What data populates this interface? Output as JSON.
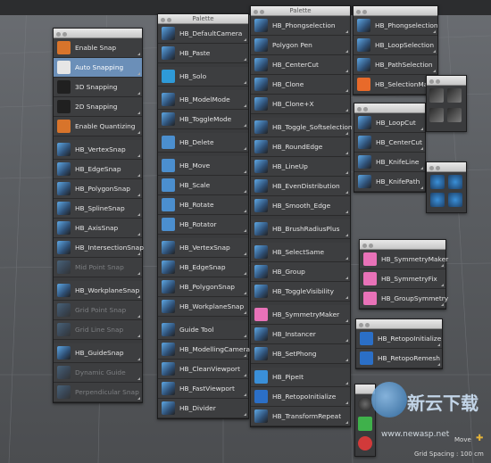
{
  "palette_title": "Palette",
  "colors": {
    "selected": "#6b8fb8",
    "panel": "#3d3e40",
    "titlebar": "#d6d6d6"
  },
  "snap_palette": {
    "items": [
      {
        "label": "Enable Snap",
        "icon": "magnet-icon",
        "state": "normal"
      },
      {
        "label": "Auto Snapping",
        "icon": "auto-snap-icon",
        "state": "selected"
      },
      {
        "label": "3D Snapping",
        "icon": "3d-snap-icon",
        "state": "normal"
      },
      {
        "label": "2D Snapping",
        "icon": "2d-snap-icon",
        "state": "normal"
      },
      {
        "label": "Enable Quantizing",
        "icon": "quantize-icon",
        "state": "normal"
      },
      {
        "label": "HB_VertexSnap",
        "icon": "vertex-snap-icon",
        "state": "normal"
      },
      {
        "label": "HB_EdgeSnap",
        "icon": "edge-snap-icon",
        "state": "normal"
      },
      {
        "label": "HB_PolygonSnap",
        "icon": "polygon-snap-icon",
        "state": "normal"
      },
      {
        "label": "HB_SplineSnap",
        "icon": "spline-snap-icon",
        "state": "normal"
      },
      {
        "label": "HB_AxisSnap",
        "icon": "axis-snap-icon",
        "state": "normal"
      },
      {
        "label": "HB_IntersectionSnap",
        "icon": "intersection-snap-icon",
        "state": "normal"
      },
      {
        "label": "Mid Point Snap",
        "icon": "midpoint-snap-icon",
        "state": "disabled"
      },
      {
        "label": "HB_WorkplaneSnap",
        "icon": "workplane-snap-icon",
        "state": "normal"
      },
      {
        "label": "Grid Point Snap",
        "icon": "grid-point-icon",
        "state": "disabled"
      },
      {
        "label": "Grid Line Snap",
        "icon": "grid-line-icon",
        "state": "disabled"
      },
      {
        "label": "HB_GuideSnap",
        "icon": "guide-snap-icon",
        "state": "normal"
      },
      {
        "label": "Dynamic Guide",
        "icon": "dynamic-guide-icon",
        "state": "disabled"
      },
      {
        "label": "Perpendicular Snap",
        "icon": "perpendicular-snap-icon",
        "state": "disabled"
      }
    ]
  },
  "palette2": {
    "items": [
      {
        "label": "HB_DefaultCamera",
        "icon": "camera-icon"
      },
      {
        "label": "HB_Paste",
        "icon": "paste-icon"
      },
      {
        "label": "HB_Solo",
        "icon": "solo-icon"
      },
      {
        "label": "HB_ModelMode",
        "icon": "model-mode-icon"
      },
      {
        "label": "HB_ToggleMode",
        "icon": "toggle-mode-icon"
      },
      {
        "label": "HB_Delete",
        "icon": "trash-icon"
      },
      {
        "label": "HB_Move",
        "icon": "move-icon"
      },
      {
        "label": "HB_Scale",
        "icon": "scale-icon"
      },
      {
        "label": "HB_Rotate",
        "icon": "rotate-icon"
      },
      {
        "label": "HB_Rotator",
        "icon": "rotator-icon"
      },
      {
        "label": "HB_VertexSnap",
        "icon": "vertex-snap-icon"
      },
      {
        "label": "HB_EdgeSnap",
        "icon": "edge-snap-icon"
      },
      {
        "label": "HB_PolygonSnap",
        "icon": "polygon-snap-icon"
      },
      {
        "label": "HB_WorkplaneSnap",
        "icon": "workplane-snap-icon"
      },
      {
        "label": "Guide Tool",
        "icon": "guide-tool-icon"
      },
      {
        "label": "HB_ModellingCamera",
        "icon": "modelling-camera-icon"
      },
      {
        "label": "HB_CleanViewport",
        "icon": "clean-viewport-icon"
      },
      {
        "label": "HB_FastViewport",
        "icon": "fast-viewport-icon"
      },
      {
        "label": "HB_Divider",
        "icon": "divider-icon"
      }
    ]
  },
  "palette3": {
    "items": [
      {
        "label": "HB_Phongselection",
        "icon": "phong-selection-icon"
      },
      {
        "label": "Polygon Pen",
        "icon": "polygon-pen-icon"
      },
      {
        "label": "HB_CenterCut",
        "icon": "center-cut-icon"
      },
      {
        "label": "HB_Clone",
        "icon": "clone-icon"
      },
      {
        "label": "HB_Clone+X",
        "icon": "clone-x-icon"
      },
      {
        "label": "HB_Toggle_Softselection",
        "icon": "soft-selection-icon"
      },
      {
        "label": "HB_RoundEdge",
        "icon": "round-edge-icon"
      },
      {
        "label": "HB_LineUp",
        "icon": "line-up-icon"
      },
      {
        "label": "HB_EvenDistribution",
        "icon": "even-distribution-icon"
      },
      {
        "label": "HB_Smooth_Edge",
        "icon": "smooth-edge-icon"
      },
      {
        "label": "HB_BrushRadiusPlus",
        "icon": "brush-radius-icon"
      },
      {
        "label": "HB_SelectSame",
        "icon": "select-same-icon"
      },
      {
        "label": "HB_Group",
        "icon": "group-icon"
      },
      {
        "label": "HB_ToggleVisibility",
        "icon": "toggle-visibility-icon"
      },
      {
        "label": "HB_SymmetryMaker",
        "icon": "symmetry-maker-icon"
      },
      {
        "label": "HB_Instancer",
        "icon": "instancer-icon"
      },
      {
        "label": "HB_SetPhong",
        "icon": "set-phong-icon"
      },
      {
        "label": "HB_PipeIt",
        "icon": "pipe-icon"
      },
      {
        "label": "HB_RetopoInitialize",
        "icon": "retopo-init-icon"
      },
      {
        "label": "HB_TransformRepeat",
        "icon": "transform-repeat-icon"
      }
    ]
  },
  "palette4": {
    "items": [
      {
        "label": "HB_Phongselection",
        "icon": "phong-selection-icon"
      },
      {
        "label": "HB_LoopSelection",
        "icon": "loop-selection-icon"
      },
      {
        "label": "HB_PathSelection",
        "icon": "path-selection-icon"
      },
      {
        "label": "HB_SelectionMaker",
        "icon": "selection-maker-icon"
      }
    ]
  },
  "palette5": {
    "items": [
      {
        "label": "HB_LoopCut",
        "icon": "loop-cut-icon"
      },
      {
        "label": "HB_CenterCut",
        "icon": "center-cut-icon"
      },
      {
        "label": "HB_KnifeLine",
        "icon": "knife-line-icon"
      },
      {
        "label": "HB_KnifePath",
        "icon": "knife-path-icon"
      }
    ]
  },
  "palette6": {
    "items": [
      {
        "label": "HB_SymmetryMaker",
        "icon": "symmetry-maker-icon"
      },
      {
        "label": "HB_SymmetryFix",
        "icon": "symmetry-fix-icon"
      },
      {
        "label": "HB_GroupSymmetry",
        "icon": "group-symmetry-icon"
      }
    ]
  },
  "palette7": {
    "items": [
      {
        "label": "HB_RetopoInitialize",
        "icon": "retopo-init-icon"
      },
      {
        "label": "HB_RetopoRemesh",
        "icon": "retopo-remesh-icon"
      }
    ]
  },
  "status": {
    "move_label": "Move",
    "grid_spacing": "Grid Spacing : 100 cm"
  },
  "watermark": {
    "text": "新云下载",
    "url": "www.newasp.net"
  }
}
